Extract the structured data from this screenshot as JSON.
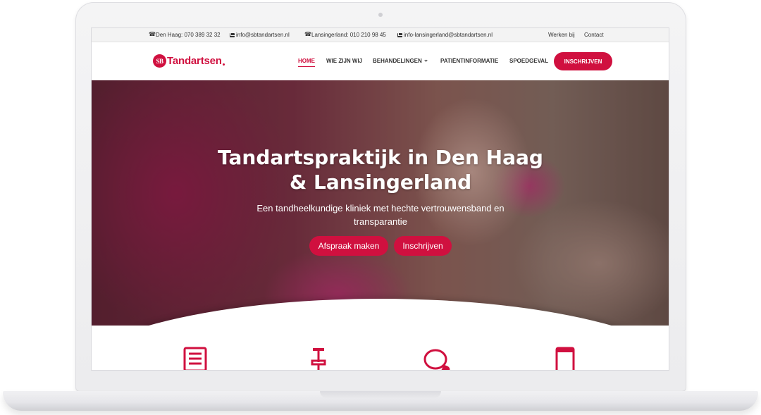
{
  "topbar": {
    "phone1": "Den Haag: 070 389 32 32",
    "email1": "info@sbtandartsen.nl",
    "phone2": "Lansingerland: 010 210 98 45",
    "email2": "info-lansingerland@sbtandartsen.nl",
    "link1": "Werken bij",
    "link2": "Contact"
  },
  "nav": {
    "logo_badge": "SB",
    "logo_text": "Tandartsen",
    "items": [
      "HOME",
      "WIE ZIJN WIJ",
      "BEHANDELINGEN",
      "PATIËNTINFORMATIE",
      "SPOEDGEVAL"
    ],
    "cta": "INSCHRIJVEN"
  },
  "hero": {
    "title_line1": "Tandartspraktijk in Den Haag",
    "title_line2": "& Lansingerland",
    "subtitle": "Een tandheelkundige kliniek met hechte vertrouwensband en transparantie",
    "btn1": "Afspraak maken",
    "btn2": "Inschrijven"
  },
  "colors": {
    "brand": "#d0103f"
  },
  "features": [
    "document-icon",
    "pin-icon",
    "chat-icon",
    "mobile-icon"
  ]
}
